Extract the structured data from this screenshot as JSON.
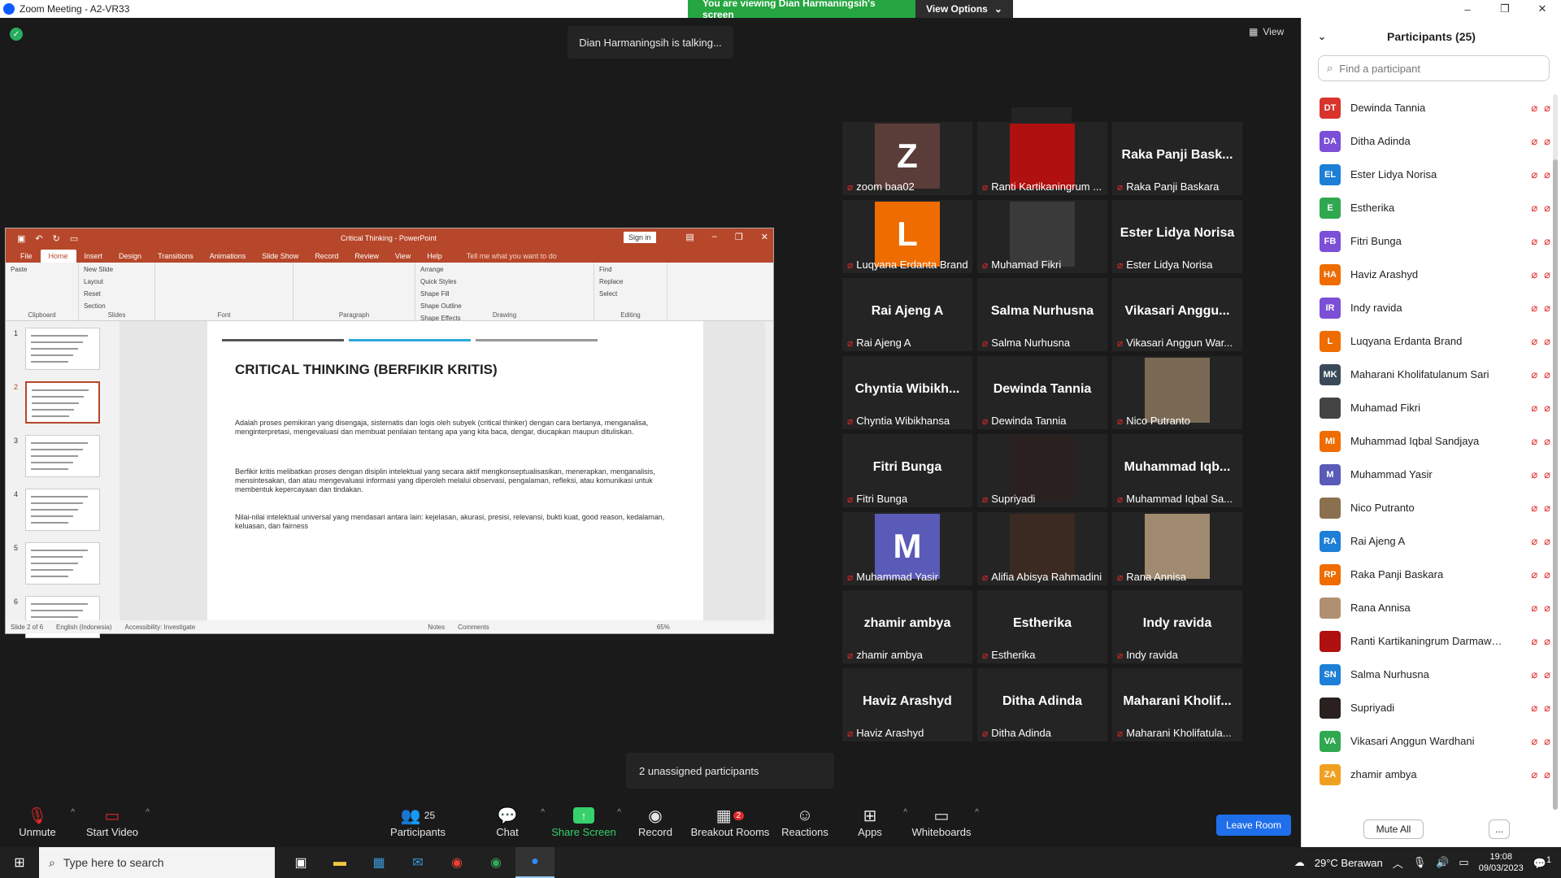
{
  "window": {
    "title": "Zoom Meeting - A2-VR33",
    "minimize": "–",
    "maximize": "❐",
    "close": "✕"
  },
  "banner": {
    "viewing": "You are viewing Dian Harmaningsih's screen",
    "view_options": "View Options"
  },
  "talking": "Dian Harmaningsih is talking...",
  "view_label": "View",
  "ppt": {
    "title": "Critical Thinking  -  PowerPoint",
    "signin": "Sign in",
    "tabs": [
      "File",
      "Home",
      "Insert",
      "Design",
      "Transitions",
      "Animations",
      "Slide Show",
      "Record",
      "Review",
      "View",
      "Help"
    ],
    "tell_me": "Tell me what you want to do",
    "groups": [
      {
        "label": "Clipboard",
        "items": [
          "Paste"
        ]
      },
      {
        "label": "Slides",
        "items": [
          "New Slide",
          "Layout",
          "Reset",
          "Section"
        ]
      },
      {
        "label": "Font",
        "items": []
      },
      {
        "label": "Paragraph",
        "items": []
      },
      {
        "label": "Drawing",
        "items": [
          "Arrange",
          "Quick Styles",
          "Shape Fill",
          "Shape Outline",
          "Shape Effects"
        ]
      },
      {
        "label": "Editing",
        "items": [
          "Find",
          "Replace",
          "Select"
        ]
      }
    ],
    "thumbs": [
      "1",
      "2",
      "3",
      "4",
      "5",
      "6"
    ],
    "slide": {
      "heading": "CRITICAL THINKING (BERFIKIR KRITIS)",
      "p1": "Adalah proses pemikiran yang disengaja, sistematis dan logis oleh subyek (critical thinker) dengan cara bertanya, menganalisa, menginterpretasi, mengevaluasi dan membuat penilaian tentang apa yang kita baca, dengar, diucapkan maupun dituliskan.",
      "p2": "Berfikir kritis melibatkan  proses dengan disiplin intelektual yang secara aktif mengkonseptualisasikan, menerapkan, menganalisis, mensintesakan, dan atau mengevaluasi informasi yang diperoleh melalui observasi, pengalaman, refleksi, atau komunikasi untuk membentuk kepercayaan dan tindakan.",
      "p3": "Nilai-nilai  intelektual universal yang mendasari antara lain: kejelasan, akurasi, presisi, relevansi, bukti kuat, good reason, kedalaman, keluasan, dan fairness"
    },
    "status": {
      "slide": "Slide 2 of 6",
      "lang": "English (Indonesia)",
      "access": "Accessibility: Investigate",
      "notes": "Notes",
      "comments": "Comments",
      "zoom": "65%"
    }
  },
  "tiles": [
    {
      "label": "zoom baa02",
      "big": "",
      "avatar": "Z",
      "color": "#5a3c38",
      "photo": false
    },
    {
      "label": "Ranti Kartikaningrum ...",
      "big": "",
      "avatar": "",
      "color": "#b01010",
      "photo": true
    },
    {
      "label": "Raka Panji Baskara",
      "big": "Raka Panji Bask...",
      "avatar": "",
      "color": "",
      "photo": false
    },
    {
      "label": "Luqyana Erdanta Brand",
      "big": "",
      "avatar": "L",
      "color": "#ee6c00",
      "photo": false
    },
    {
      "label": "Muhamad Fikri",
      "big": "",
      "avatar": "",
      "color": "#3a3a3a",
      "photo": true
    },
    {
      "label": "Ester Lidya Norisa",
      "big": "Ester Lidya Norisa",
      "avatar": "",
      "color": "",
      "photo": false
    },
    {
      "label": "Rai Ajeng A",
      "big": "Rai Ajeng A",
      "avatar": "",
      "color": "",
      "photo": false
    },
    {
      "label": "Salma Nurhusna",
      "big": "Salma Nurhusna",
      "avatar": "",
      "color": "",
      "photo": false
    },
    {
      "label": "Vikasari Anggun War...",
      "big": "Vikasari  Anggu...",
      "avatar": "",
      "color": "",
      "photo": false
    },
    {
      "label": "Chyntia Wibikhansa",
      "big": "Chyntia  Wibikh...",
      "avatar": "",
      "color": "",
      "photo": false
    },
    {
      "label": "Dewinda Tannia",
      "big": "Dewinda Tannia",
      "avatar": "",
      "color": "",
      "photo": false
    },
    {
      "label": "Nico Putranto",
      "big": "",
      "avatar": "",
      "color": "#7a6a55",
      "photo": true
    },
    {
      "label": "Fitri Bunga",
      "big": "Fitri Bunga",
      "avatar": "",
      "color": "",
      "photo": false
    },
    {
      "label": "Supriyadi",
      "big": "",
      "avatar": "",
      "color": "#2a2020",
      "photo": true
    },
    {
      "label": "Muhammad Iqbal Sa...",
      "big": "Muhammad  Iqb...",
      "avatar": "",
      "color": "",
      "photo": false
    },
    {
      "label": "Muhammad Yasir",
      "big": "",
      "avatar": "M",
      "color": "#5a5ab8",
      "photo": false
    },
    {
      "label": "Alifia Abisya Rahmadini",
      "big": "",
      "avatar": "",
      "color": "#3a2a22",
      "photo": true
    },
    {
      "label": "Rana Annisa",
      "big": "",
      "avatar": "",
      "color": "#a08a70",
      "photo": true
    },
    {
      "label": "zhamir ambya",
      "big": "zhamir ambya",
      "avatar": "",
      "color": "",
      "photo": false
    },
    {
      "label": "Estherika",
      "big": "Estherika",
      "avatar": "",
      "color": "",
      "photo": false
    },
    {
      "label": "Indy ravida",
      "big": "Indy ravida",
      "avatar": "",
      "color": "",
      "photo": false
    },
    {
      "label": "Haviz Arashyd",
      "big": "Haviz Arashyd",
      "avatar": "",
      "color": "",
      "photo": false
    },
    {
      "label": "Ditha Adinda",
      "big": "Ditha Adinda",
      "avatar": "",
      "color": "",
      "photo": false
    },
    {
      "label": "Maharani Kholifatula...",
      "big": "Maharani  Kholif...",
      "avatar": "",
      "color": "",
      "photo": false
    }
  ],
  "unassigned": "2 unassigned participants",
  "toolbar": {
    "unmute": "Unmute",
    "start_video": "Start Video",
    "participants": "Participants",
    "participants_count": "25",
    "chat": "Chat",
    "share": "Share Screen",
    "record": "Record",
    "breakout": "Breakout Rooms",
    "breakout_badge": "2",
    "reactions": "Reactions",
    "apps": "Apps",
    "whiteboards": "Whiteboards",
    "leave": "Leave Room"
  },
  "panel": {
    "title": "Participants (25)",
    "search_placeholder": "Find a participant",
    "mute_all": "Mute All",
    "more": "...",
    "participants": [
      {
        "name": "Dewinda Tannia",
        "initials": "DT",
        "color": "#d9342b"
      },
      {
        "name": "Ditha Adinda",
        "initials": "DA",
        "color": "#7b4fd6"
      },
      {
        "name": "Ester Lidya Norisa",
        "initials": "EL",
        "color": "#1d7fd6"
      },
      {
        "name": "Estherika",
        "initials": "E",
        "color": "#2fa84f"
      },
      {
        "name": "Fitri Bunga",
        "initials": "FB",
        "color": "#7b4fd6"
      },
      {
        "name": "Haviz Arashyd",
        "initials": "HA",
        "color": "#ee6c00"
      },
      {
        "name": "Indy ravida",
        "initials": "IR",
        "color": "#7b4fd6"
      },
      {
        "name": "Luqyana Erdanta Brand",
        "initials": "L",
        "color": "#ee6c00"
      },
      {
        "name": "Maharani Kholifatulanum Sari",
        "initials": "MK",
        "color": "#3b4a5a"
      },
      {
        "name": "Muhamad Fikri",
        "initials": "",
        "color": "#444444"
      },
      {
        "name": "Muhammad Iqbal Sandjaya",
        "initials": "MI",
        "color": "#ee6c00"
      },
      {
        "name": "Muhammad Yasir",
        "initials": "M",
        "color": "#5a5ab8"
      },
      {
        "name": "Nico Putranto",
        "initials": "",
        "color": "#8a7050"
      },
      {
        "name": "Rai Ajeng A",
        "initials": "RA",
        "color": "#1d7fd6"
      },
      {
        "name": "Raka Panji Baskara",
        "initials": "RP",
        "color": "#ee6c00"
      },
      {
        "name": "Rana Annisa",
        "initials": "",
        "color": "#b09070"
      },
      {
        "name": "Ranti Kartikaningrum Darmawa...",
        "initials": "",
        "color": "#b01010"
      },
      {
        "name": "Salma Nurhusna",
        "initials": "SN",
        "color": "#1d7fd6"
      },
      {
        "name": "Supriyadi",
        "initials": "",
        "color": "#2a2020"
      },
      {
        "name": "Vikasari Anggun Wardhani",
        "initials": "VA",
        "color": "#2fa84f"
      },
      {
        "name": "zhamir ambya",
        "initials": "ZA",
        "color": "#f0a020"
      }
    ]
  },
  "taskbar": {
    "search": "Type here to search",
    "weather": "29°C  Berawan",
    "time": "19:08",
    "date": "09/03/2023",
    "notif": "1"
  }
}
